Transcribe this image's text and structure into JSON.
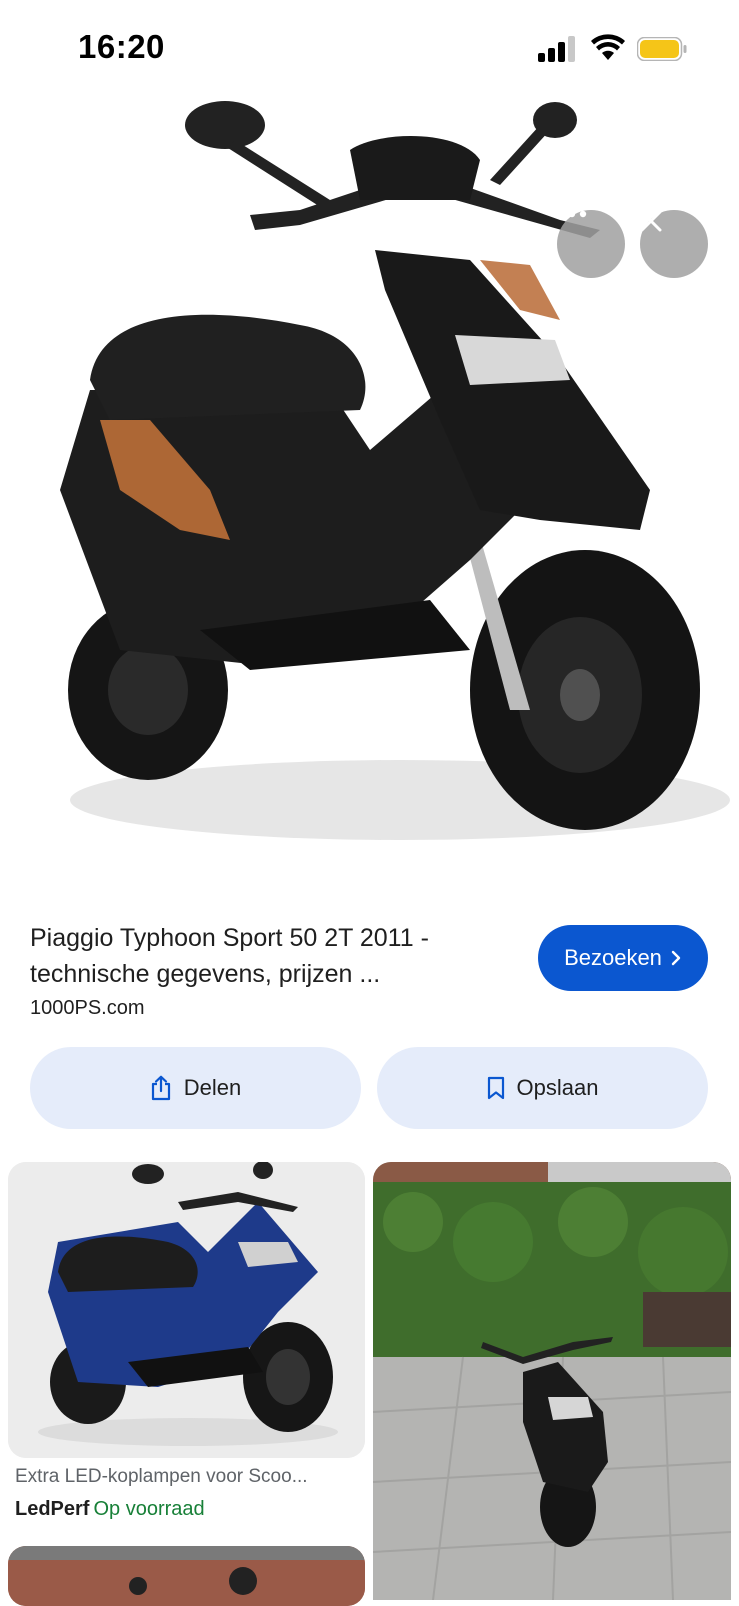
{
  "status_bar": {
    "time": "16:20",
    "battery_color": "#f5c518"
  },
  "hero": {
    "more_icon": "more-horizontal-icon",
    "close_icon": "close-icon",
    "lens_icon": "lens-icon"
  },
  "result": {
    "title": "Piaggio Typhoon Sport 50 2T 2011 - technische gegevens, prijzen ...",
    "source": "1000PS.com",
    "visit_label": "Bezoeken",
    "share_label": "Delen",
    "save_label": "Opslaan"
  },
  "related": [
    {
      "caption": "Extra LED-koplampen voor Scoo...",
      "store": "LedPerf",
      "availability": "Op voorraad"
    }
  ],
  "colors": {
    "accent": "#0b57d0",
    "chip_bg": "#e5ecfa",
    "in_stock": "#188038"
  }
}
